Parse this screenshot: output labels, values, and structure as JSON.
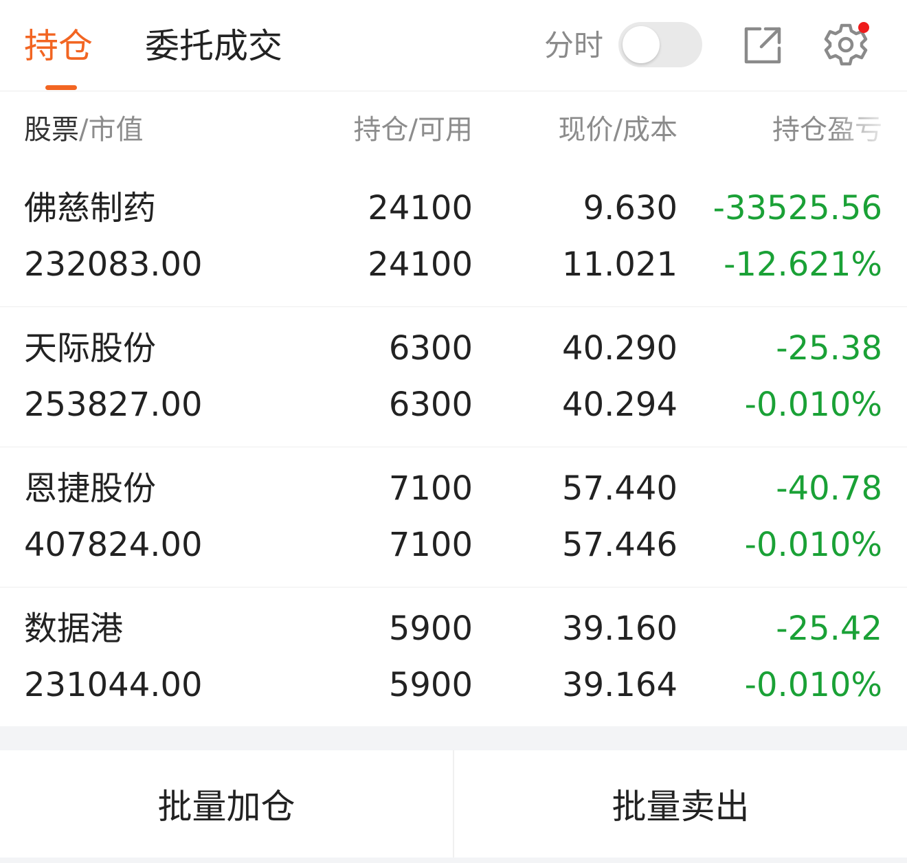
{
  "tabs": [
    {
      "label": "持仓",
      "active": true
    },
    {
      "label": "委托成交",
      "active": false
    }
  ],
  "toggle": {
    "label": "分时",
    "on": false
  },
  "icons": {
    "share": "share-icon",
    "settings": "gear-icon"
  },
  "colors": {
    "accent": "#f26522",
    "loss": "#1aa136",
    "dot": "#ee1c1c"
  },
  "header": {
    "col1_main": "股票",
    "col1_sub": "/市值",
    "col2": "持仓/可用",
    "col3": "现价/成本",
    "col4": "持仓盈亏"
  },
  "rows": [
    {
      "name": "佛慈制药",
      "market_value": "232083.00",
      "position": "24100",
      "available": "24100",
      "price": "9.630",
      "cost": "11.021",
      "pnl": "-33525.56",
      "pnl_pct": "-12.621%"
    },
    {
      "name": "天际股份",
      "market_value": "253827.00",
      "position": "6300",
      "available": "6300",
      "price": "40.290",
      "cost": "40.294",
      "pnl": "-25.38",
      "pnl_pct": "-0.010%"
    },
    {
      "name": "恩捷股份",
      "market_value": "407824.00",
      "position": "7100",
      "available": "7100",
      "price": "57.440",
      "cost": "57.446",
      "pnl": "-40.78",
      "pnl_pct": "-0.010%"
    },
    {
      "name": "数据港",
      "market_value": "231044.00",
      "position": "5900",
      "available": "5900",
      "price": "39.160",
      "cost": "39.164",
      "pnl": "-25.42",
      "pnl_pct": "-0.010%"
    }
  ],
  "actions": {
    "batch_add": "批量加仓",
    "batch_sell": "批量卖出"
  }
}
